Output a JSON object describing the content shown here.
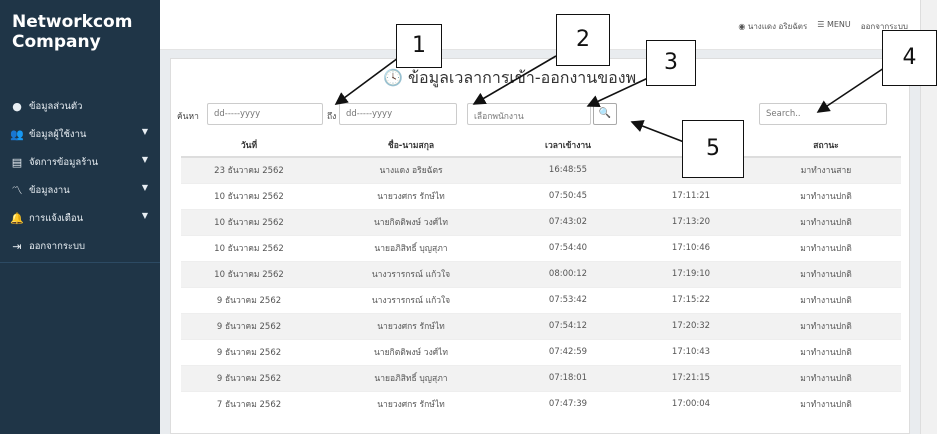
{
  "brand": {
    "line1": "Networkcom",
    "line2": "Company"
  },
  "sidebar": {
    "items": [
      {
        "label": "ข้อมูลส่วนตัว",
        "icon": "user-circle-icon",
        "caret": false
      },
      {
        "label": "ข้อมูลผู้ใช้งาน",
        "icon": "users-icon",
        "caret": true
      },
      {
        "label": "จัดการข้อมูลร้าน",
        "icon": "document-icon",
        "caret": true
      },
      {
        "label": "ข้อมูลงาน",
        "icon": "chart-line-icon",
        "caret": true
      },
      {
        "label": "การแจ้งเตือน",
        "icon": "bell-icon",
        "caret": true
      },
      {
        "label": "ออกจากระบบ",
        "icon": "sign-out-icon",
        "caret": false
      }
    ]
  },
  "topnav": {
    "user": "นางแดง อริยฉัตร",
    "menu": "MENU",
    "logout": "ออกจากระบบ"
  },
  "page": {
    "title": "ข้อมูลเวลาการเข้า-ออกงานของพ"
  },
  "filters": {
    "search_label": "ค้นหา",
    "date_from_placeholder": "dd-----yyyy",
    "to_label": "ถึง",
    "date_to_placeholder": "dd-----yyyy",
    "employee_placeholder": "เลือกพนักงาน",
    "search_placeholder": "Search.."
  },
  "table": {
    "headers": [
      "วันที่",
      "ชื่อ-นามสกุล",
      "เวลาเข้างาน",
      "",
      "สถานะ"
    ],
    "rows": [
      [
        "23 ธันวาคม 2562",
        "นางแดง อริยฉัตร",
        "16:48:55",
        "",
        "มาทำงานสาย"
      ],
      [
        "10 ธันวาคม 2562",
        "นายวงศกร รักษ์ไท",
        "07:50:45",
        "17:11:21",
        "มาทำงานปกติ"
      ],
      [
        "10 ธันวาคม 2562",
        "นายกิตติพงษ์ วงศ์ไท",
        "07:43:02",
        "17:13:20",
        "มาทำงานปกติ"
      ],
      [
        "10 ธันวาคม 2562",
        "นายอภิสิทธิ์ บุญสุภา",
        "07:54:40",
        "17:10:46",
        "มาทำงานปกติ"
      ],
      [
        "10 ธันวาคม 2562",
        "นางวรารกรณ์ แก้วใจ",
        "08:00:12",
        "17:19:10",
        "มาทำงานปกติ"
      ],
      [
        "9 ธันวาคม 2562",
        "นางวรารกรณ์ แก้วใจ",
        "07:53:42",
        "17:15:22",
        "มาทำงานปกติ"
      ],
      [
        "9 ธันวาคม 2562",
        "นายวงศกร รักษ์ไท",
        "07:54:12",
        "17:20:32",
        "มาทำงานปกติ"
      ],
      [
        "9 ธันวาคม 2562",
        "นายกิตติพงษ์ วงศ์ไท",
        "07:42:59",
        "17:10:43",
        "มาทำงานปกติ"
      ],
      [
        "9 ธันวาคม 2562",
        "นายอภิสิทธิ์ บุญสุภา",
        "07:18:01",
        "17:21:15",
        "มาทำงานปกติ"
      ],
      [
        "7 ธันวาคม 2562",
        "นายวงศกร รักษ์ไท",
        "07:47:39",
        "17:00:04",
        "มาทำงานปกติ"
      ]
    ]
  },
  "callouts": [
    "1",
    "2",
    "3",
    "4",
    "5"
  ]
}
